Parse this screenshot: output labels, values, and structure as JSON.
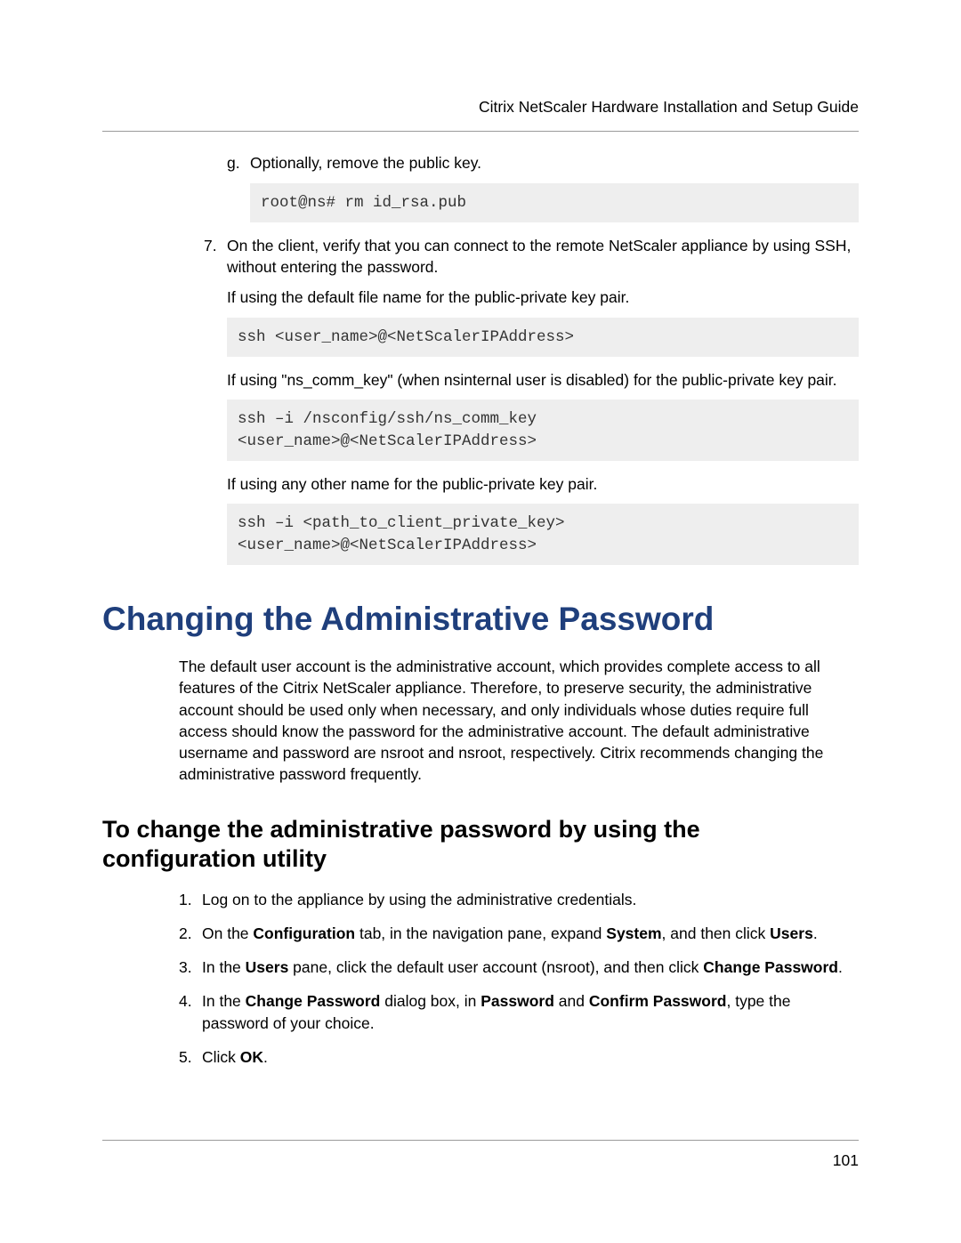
{
  "header": {
    "title": "Citrix NetScaler Hardware Installation and Setup Guide"
  },
  "sec1": {
    "g_marker": "g.",
    "g_text": "Optionally, remove the public key.",
    "code_g": "root@ns# rm id_rsa.pub",
    "item7_marker": "7.",
    "item7_text": "On the client, verify that you can connect to the remote NetScaler appliance by using SSH, without entering the password.",
    "p1": "If using the default file name for the public-private key pair.",
    "code1": "ssh <user_name>@<NetScalerIPAddress>",
    "p2": "If using \"ns_comm_key\" (when nsinternal user is disabled) for the public-private key pair.",
    "code2": "ssh –i /nsconfig/ssh/ns_comm_key \n<user_name>@<NetScalerIPAddress>",
    "p3": "If using any other name for the public-private key pair.",
    "code3": "ssh –i <path_to_client_private_key> \n<user_name>@<NetScalerIPAddress>"
  },
  "h1": "Changing the Administrative Password",
  "intro": "The default user account is the administrative account, which provides complete access to all features of the Citrix NetScaler appliance. Therefore, to preserve security, the administrative account should be used only when necessary, and only individuals whose duties require full access should know the password for the administrative account. The default administrative username and password are nsroot and nsroot, respectively. Citrix recommends changing the administrative password frequently.",
  "h2": "To change the administrative password by using the configuration utility",
  "steps": {
    "m1": "1.",
    "t1": "Log on to the appliance by using the administrative credentials.",
    "m2": "2.",
    "t2a": "On the ",
    "t2b": "Configuration",
    "t2c": " tab, in the navigation pane, expand ",
    "t2d": "System",
    "t2e": ", and then click ",
    "t2f": "Users",
    "t2g": ".",
    "m3": "3.",
    "t3a": "In the ",
    "t3b": "Users",
    "t3c": " pane, click the default user account (nsroot), and then click ",
    "t3d": "Change Password",
    "t3e": ".",
    "m4": "4.",
    "t4a": "In the ",
    "t4b": "Change Password",
    "t4c": " dialog box, in ",
    "t4d": "Password",
    "t4e": " and ",
    "t4f": "Confirm Password",
    "t4g": ", type the password of your choice.",
    "m5": "5.",
    "t5a": "Click ",
    "t5b": "OK",
    "t5c": "."
  },
  "page_number": "101"
}
